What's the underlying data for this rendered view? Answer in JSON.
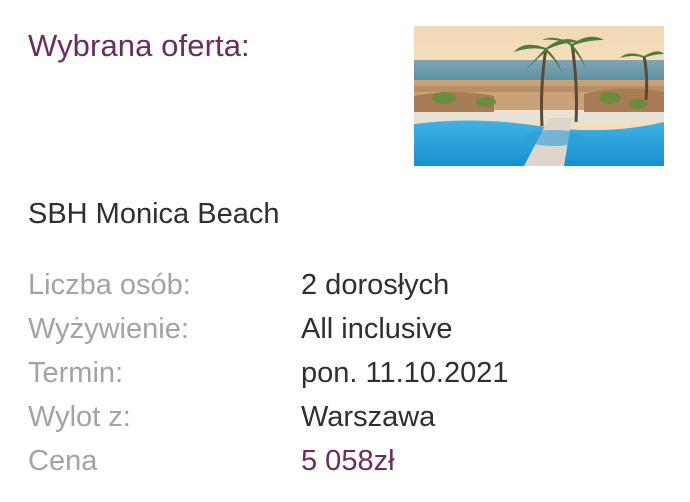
{
  "offer": {
    "heading": "Wybrana oferta:",
    "hotel_name": "SBH Monica Beach",
    "details": [
      {
        "label": "Liczba osób:",
        "value": "2 dorosłych"
      },
      {
        "label": "Wyżywienie:",
        "value": "All inclusive"
      },
      {
        "label": "Termin:",
        "value": "pon. 11.10.2021"
      },
      {
        "label": "Wylot z:",
        "value": "Warszawa"
      },
      {
        "label": "Cena",
        "value": "5 058zł"
      }
    ]
  },
  "colors": {
    "accent": "#6b2c5f",
    "label": "#a3a3a3",
    "text": "#2f2f2f"
  },
  "icons": {
    "hotel_photo": "hotel-photo-pool-palms"
  }
}
